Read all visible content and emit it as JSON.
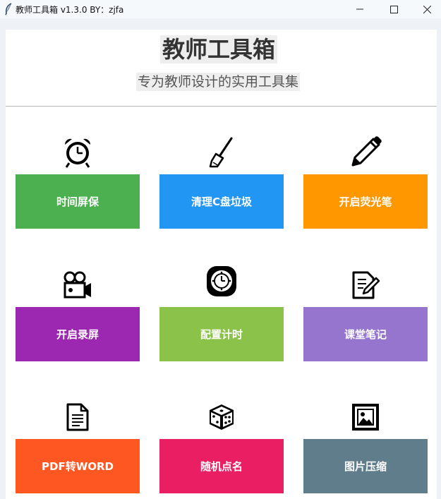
{
  "window": {
    "title": "教师工具箱 v1.3.0   BY：zjfa"
  },
  "header": {
    "title": "教师工具箱",
    "subtitle": "专为教师设计的实用工具集"
  },
  "tools": [
    {
      "label": "时间屏保",
      "icon": "alarm-clock-icon",
      "color": "#4caf50"
    },
    {
      "label": "清理C盘垃圾",
      "icon": "broom-icon",
      "color": "#2196f3"
    },
    {
      "label": "开启荧光笔",
      "icon": "pencil-icon",
      "color": "#ff9800"
    },
    {
      "label": "开启录屏",
      "icon": "video-camera-icon",
      "color": "#9c27b0"
    },
    {
      "label": "配置计时",
      "icon": "timer-dial-icon",
      "color": "#8bc34a"
    },
    {
      "label": "课堂笔记",
      "icon": "note-edit-icon",
      "color": "#9575cd"
    },
    {
      "label": "PDF转WORD",
      "icon": "document-icon",
      "color": "#ff5722"
    },
    {
      "label": "随机点名",
      "icon": "dice-icon",
      "color": "#e91e63"
    },
    {
      "label": "图片压缩",
      "icon": "image-icon",
      "color": "#607d8b"
    }
  ]
}
